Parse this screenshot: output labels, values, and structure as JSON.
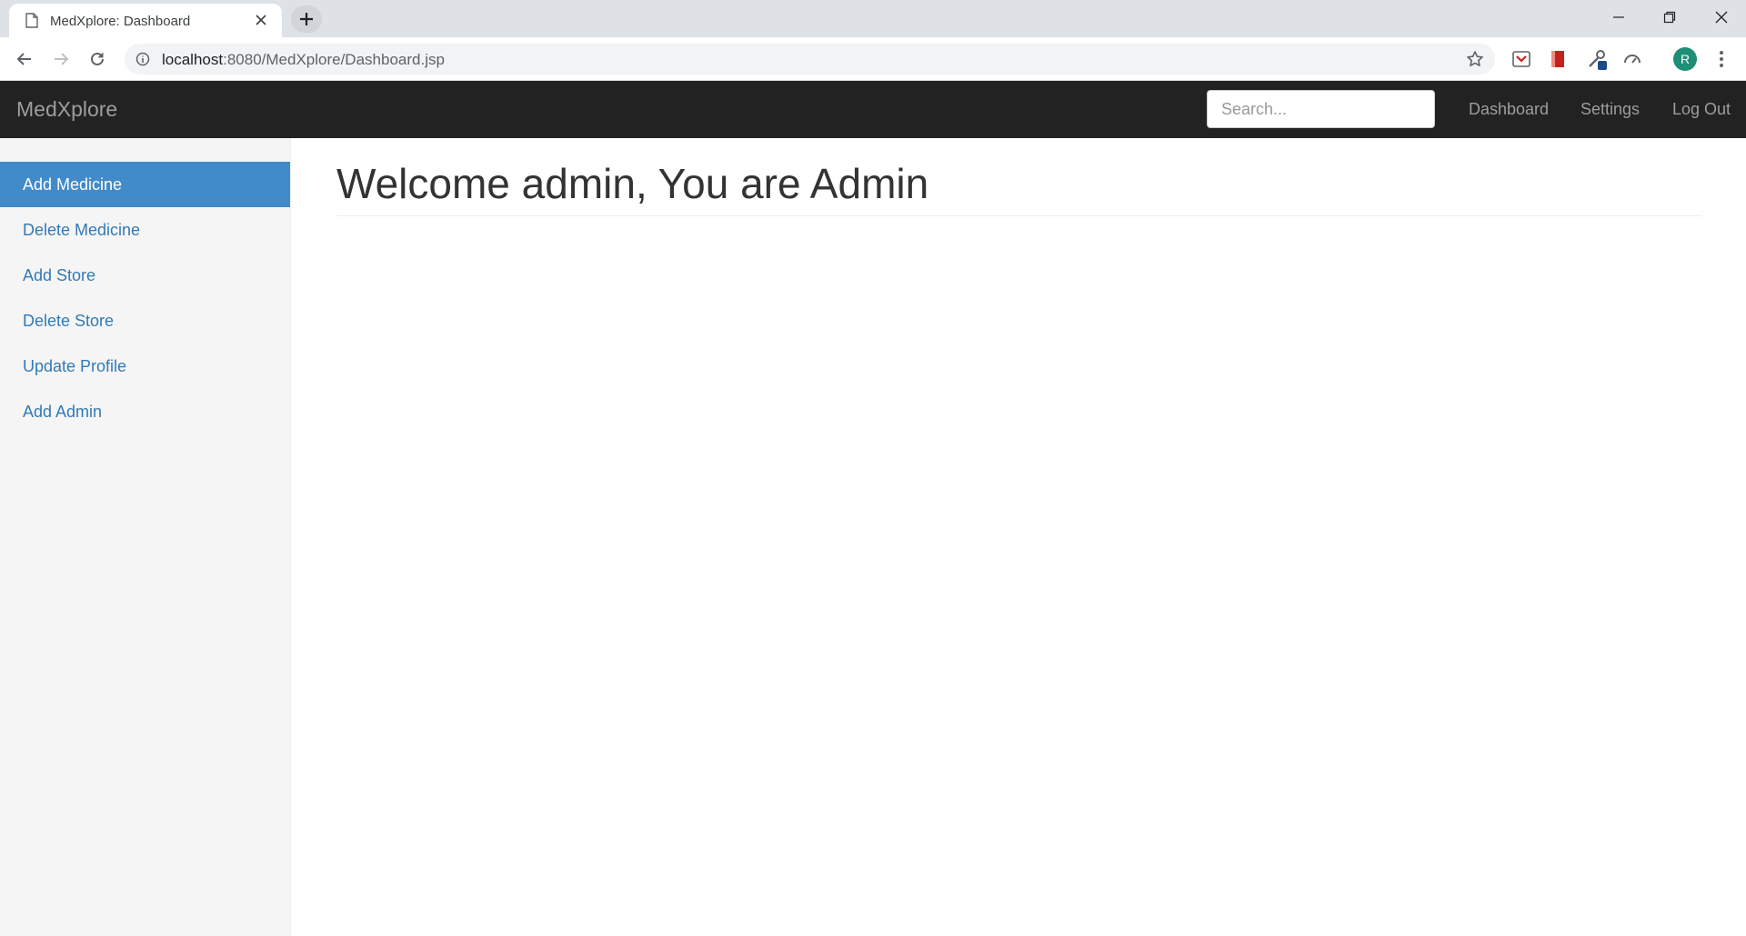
{
  "browser": {
    "tab_title": "MedXplore: Dashboard",
    "url_host": "localhost",
    "url_rest": ":8080/MedXplore/Dashboard.jsp",
    "profile_initial": "R"
  },
  "navbar": {
    "brand": "MedXplore",
    "search_placeholder": "Search...",
    "links": [
      "Dashboard",
      "Settings",
      "Log Out"
    ]
  },
  "sidebar": {
    "items": [
      {
        "label": "Add Medicine",
        "active": true
      },
      {
        "label": "Delete Medicine",
        "active": false
      },
      {
        "label": "Add Store",
        "active": false
      },
      {
        "label": "Delete Store",
        "active": false
      },
      {
        "label": "Update Profile",
        "active": false
      },
      {
        "label": "Add Admin",
        "active": false
      }
    ]
  },
  "main": {
    "heading": "Welcome admin, You are Admin"
  },
  "colors": {
    "navbar_bg": "#222222",
    "active_item": "#428bca",
    "link": "#337ab7",
    "avatar": "#1e8e76"
  }
}
